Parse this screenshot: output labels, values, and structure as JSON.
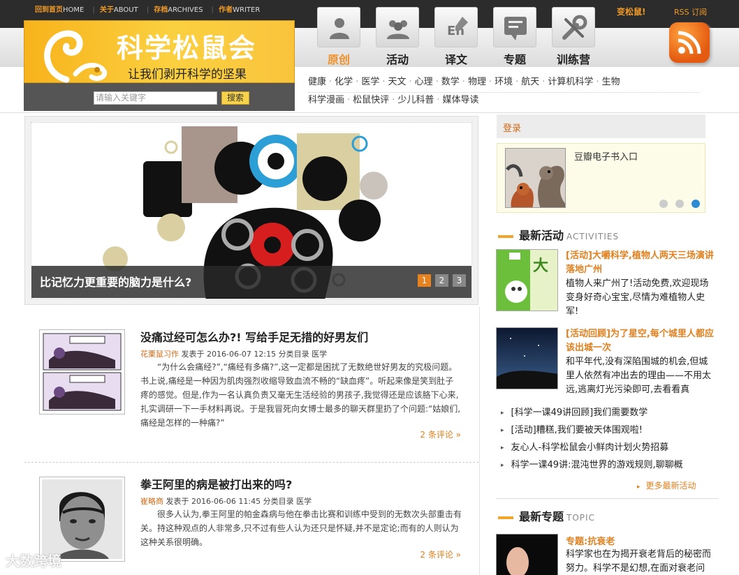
{
  "top_links": [
    {
      "cn": "回到首页",
      "en": "HOME"
    },
    {
      "cn": "关于",
      "en": "ABOUT"
    },
    {
      "cn": "存档",
      "en": "ARCHIVES"
    },
    {
      "cn": "作者",
      "en": "WRITER"
    }
  ],
  "header": {
    "bian_songshu": "变松鼠!",
    "rss_label": "RSS 订阅",
    "logo_title": "科学松鼠会",
    "logo_subtitle": "让我们剥开科学的坚果",
    "search_placeholder": "请输入关键字",
    "search_button": "搜索"
  },
  "nav": [
    {
      "label": "原创",
      "icon": "person-icon",
      "active": true
    },
    {
      "label": "活动",
      "icon": "group-icon",
      "active": false
    },
    {
      "label": "译文",
      "icon": "translate-icon",
      "active": false
    },
    {
      "label": "专题",
      "icon": "topic-icon",
      "active": false
    },
    {
      "label": "训练营",
      "icon": "tools-icon",
      "active": false
    }
  ],
  "categories_row1": [
    "健康",
    "化学",
    "医学",
    "天文",
    "心理",
    "数学",
    "物理",
    "环境",
    "航天",
    "计算机科学",
    "生物"
  ],
  "categories_row2": [
    "科学漫画",
    "松鼠快评",
    "少儿科普",
    "媒体导读"
  ],
  "slider": {
    "caption": "比记忆力更重要的脑力是什么?",
    "pages": [
      "1",
      "2",
      "3"
    ],
    "active_page": 1
  },
  "posts": [
    {
      "title": "没痛过经可怎么办?! 写给手足无措的好男友们",
      "author": "花栗鼠习作",
      "meta": "发表于 2016-06-07 12:15 分类目录 医学",
      "excerpt": "“为什么会痛经?”,“痛经有多痛?”,这一定都是困扰了无数绝世好男友的究极问题。书上说,痛经是一种因为肌肉强烈收缩导致血流不畅的“缺血疼”。听起来像是笑到肚子疼的感觉。但是,作为一名认真负责又毫无生活经验的男孩子,我觉得还是应该胳下心来,扎实调研一下一手材料再说。于是我冒死向女博士最多的聊天群里扔了个问题:“姑娘们,痛经是怎样的一种痛?”",
      "comments": "2 条评论 »",
      "thumb_icon": "comic-thumbnail"
    },
    {
      "title": "拳王阿里的病是被打出来的吗?",
      "author": "崔略商",
      "meta": "发表于 2016-06-06 11:45 分类目录 医学",
      "excerpt": "很多人认为,拳王阿里的帕金森病与他在拳击比赛和训练中受到的无数次头部重击有关。持这种观点的人非常多,只不过有些人认为还只是怀疑,并不是定论;而有的人则认为这种关系很明确。",
      "comments": "2 条评论 »",
      "thumb_icon": "portrait-thumbnail"
    }
  ],
  "sidebar": {
    "login": "登录",
    "douban_entry": "豆瓣电子书入口",
    "carousel_dots": 3,
    "carousel_active": 3,
    "activities_title": "最新活动",
    "activities_en": "ACTIVITIES",
    "activities": [
      {
        "title": "[活动]大嚼科学,植物人两天三场演讲落地广州",
        "desc": "植物人来广州了!活动免费,欢迎现场变身好奇心宝宝,尽情为难植物人史军!"
      },
      {
        "title": "[活动回顾]为了星空,每个城里人都应该出城一次",
        "desc": "和平年代,没有深陷围城的机会,但城里人依然有冲出去的理由——不用太远,逃离灯光污染即可,去看看真"
      }
    ],
    "activity_list": [
      "[科学一课49讲回顾]我们需要数学",
      "[活动]糟糕,我们要被天体围观啦!",
      "友心人-科学松鼠会小鲜肉计划火势招募",
      "科学一课49讲:混沌世界的游戏规则,聊聊概"
    ],
    "more_activities": "更多最新活动",
    "topics_title": "最新专题",
    "topics_en": "TOPIC",
    "topic": {
      "title": "专题:抗衰老",
      "desc": "科学家也在为揭开衰老背后的秘密而努力。科学不是幻想,在面对衰老问"
    }
  },
  "watermark": "大数跨境",
  "colors": {
    "accent": "#f0922b",
    "logo_yellow": "#fbd040",
    "dark_bar": "#2c2c2c"
  }
}
